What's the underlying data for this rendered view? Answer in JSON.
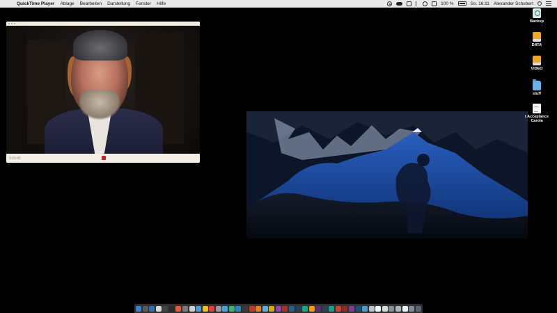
{
  "menubar": {
    "apple_glyph": "",
    "app_name": "QuickTime Player",
    "menus": [
      "Ablage",
      "Bearbeiten",
      "Darstellung",
      "Fenster",
      "Hilfe"
    ],
    "battery": "100 %",
    "datetime": "So. 16:11",
    "user": "Alexander Schubert",
    "status_icons": [
      "target-icon",
      "cloud-icon",
      "screen-icon",
      "bluetooth-icon",
      "wifi-icon",
      "volume-icon",
      "battery-icon",
      "search-icon",
      "list-icon"
    ]
  },
  "quicktime": {
    "time": "0:03:45"
  },
  "desktop_icons": [
    {
      "label": "Backup",
      "icon": "backup-drive-icon"
    },
    {
      "label": "DATA",
      "icon": "external-drive-icon"
    },
    {
      "label": "VIDEO",
      "icon": "external-drive-icon"
    },
    {
      "label": "stuff",
      "icon": "folder-icon"
    },
    {
      "label": "t Acceptance\nCarola",
      "icon": "document-icon"
    }
  ],
  "dock": {
    "colors": [
      "#3b82c4",
      "#5a5a5a",
      "#2f6fb0",
      "#d8d8d8",
      "#444",
      "#2a2a2a",
      "#e45b3a",
      "#7a7a7a",
      "#cfcfcf",
      "#4b9ad8",
      "#f0c020",
      "#e04040",
      "#9a9a9a",
      "#4aa3e0",
      "#3cb371",
      "#2e86c1",
      "#3a3a3a",
      "#c0392b",
      "#e67e22",
      "#5dade2",
      "#d4ac0d",
      "#8e44ad",
      "#a93226",
      "#1f618d",
      "#2c3e50",
      "#17a589",
      "#f39c12",
      "#5b2c6f",
      "#2e4053",
      "#16a085",
      "#cb4335",
      "#922b21",
      "#7d3c98",
      "#1a5276",
      "#5499c7",
      "#bdc3c7",
      "#f4f6f7",
      "#d5dbdb",
      "#85929e",
      "#aab7b8",
      "#ecf0f1",
      "#808b96",
      "#566573"
    ]
  }
}
